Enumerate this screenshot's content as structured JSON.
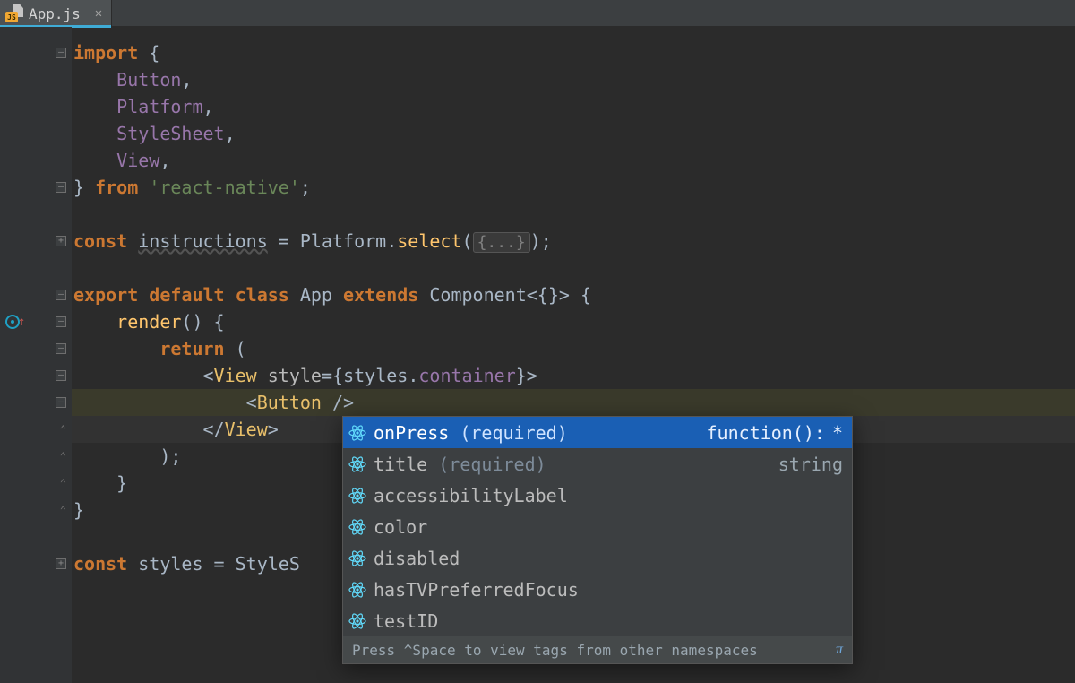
{
  "tab": {
    "filename": "App.js",
    "file_icon_badge": "JS"
  },
  "code": {
    "lines": [
      {
        "indent": 0,
        "tokens": [
          [
            "kw",
            "import"
          ],
          [
            "pun",
            " {"
          ]
        ]
      },
      {
        "indent": 1,
        "tokens": [
          [
            "imp",
            "Button"
          ],
          [
            "pun",
            ","
          ]
        ]
      },
      {
        "indent": 1,
        "tokens": [
          [
            "imp",
            "Platform"
          ],
          [
            "pun",
            ","
          ]
        ]
      },
      {
        "indent": 1,
        "tokens": [
          [
            "imp",
            "StyleSheet"
          ],
          [
            "pun",
            ","
          ]
        ]
      },
      {
        "indent": 1,
        "tokens": [
          [
            "imp",
            "View"
          ],
          [
            "pun",
            ","
          ]
        ]
      },
      {
        "indent": 0,
        "tokens": [
          [
            "pun",
            "} "
          ],
          [
            "kw",
            "from"
          ],
          [
            "pun",
            " "
          ],
          [
            "str",
            "'react-native'"
          ],
          [
            "pun",
            ";"
          ]
        ]
      },
      {
        "blank": true
      },
      {
        "indent": 0,
        "tokens": [
          [
            "kw",
            "const"
          ],
          [
            "pun",
            " "
          ],
          [
            "decl",
            "instructions"
          ],
          [
            "pun",
            " = "
          ],
          [
            "id",
            "Platform"
          ],
          [
            "pun",
            "."
          ],
          [
            "fn2",
            "select"
          ],
          [
            "pun",
            "("
          ],
          [
            "fold",
            "{...}"
          ],
          [
            "pun",
            ");"
          ]
        ],
        "fold_plus": true
      },
      {
        "blank": true
      },
      {
        "indent": 0,
        "tokens": [
          [
            "kw",
            "export default class"
          ],
          [
            "pun",
            " "
          ],
          [
            "id",
            "App"
          ],
          [
            "pun",
            " "
          ],
          [
            "kw",
            "extends"
          ],
          [
            "pun",
            " "
          ],
          [
            "id",
            "Component"
          ],
          [
            "pun",
            "<{}>"
          ],
          [
            "pun",
            " {"
          ]
        ]
      },
      {
        "indent": 1,
        "tokens": [
          [
            "fn2",
            "render"
          ],
          [
            "pun",
            "() {"
          ]
        ],
        "marker": true
      },
      {
        "indent": 2,
        "tokens": [
          [
            "kw",
            "return"
          ],
          [
            "pun",
            " ("
          ]
        ]
      },
      {
        "indent": 3,
        "tokens": [
          [
            "pun",
            "<"
          ],
          [
            "tag",
            "View"
          ],
          [
            "pun",
            " "
          ],
          [
            "attr",
            "style"
          ],
          [
            "pun",
            "={"
          ],
          [
            "id",
            "styles"
          ],
          [
            "pun",
            "."
          ],
          [
            "field",
            "container"
          ],
          [
            "pun",
            "}>"
          ]
        ]
      },
      {
        "indent": 4,
        "tokens": [
          [
            "pun",
            "<"
          ],
          [
            "tag",
            "Button"
          ],
          [
            "pun",
            " "
          ],
          [
            "pun",
            "/>"
          ]
        ],
        "hlstrong": true
      },
      {
        "indent": 3,
        "tokens": [
          [
            "pun",
            "</"
          ],
          [
            "tag",
            "View"
          ],
          [
            "pun",
            ">"
          ]
        ],
        "hl": true
      },
      {
        "indent": 2,
        "tokens": [
          [
            "pun",
            ");"
          ]
        ]
      },
      {
        "indent": 1,
        "tokens": [
          [
            "pun",
            "}"
          ]
        ]
      },
      {
        "indent": 0,
        "tokens": [
          [
            "pun",
            "}"
          ]
        ]
      },
      {
        "blank": true
      },
      {
        "indent": 0,
        "tokens": [
          [
            "kw",
            "const"
          ],
          [
            "pun",
            " "
          ],
          [
            "id",
            "styles"
          ],
          [
            "pun",
            " = "
          ],
          [
            "id",
            "StyleS"
          ]
        ],
        "fold_plus": true
      }
    ]
  },
  "completion": {
    "items": [
      {
        "label": "onPress",
        "hint": "(required)",
        "type": "function(): *",
        "selected": true
      },
      {
        "label": "title",
        "hint": "(required)",
        "type": "string"
      },
      {
        "label": "accessibilityLabel"
      },
      {
        "label": "color"
      },
      {
        "label": "disabled"
      },
      {
        "label": "hasTVPreferredFocus"
      },
      {
        "label": "testID"
      }
    ],
    "footer": "Press ^Space to view tags from other namespaces",
    "footer_icon": "π"
  }
}
